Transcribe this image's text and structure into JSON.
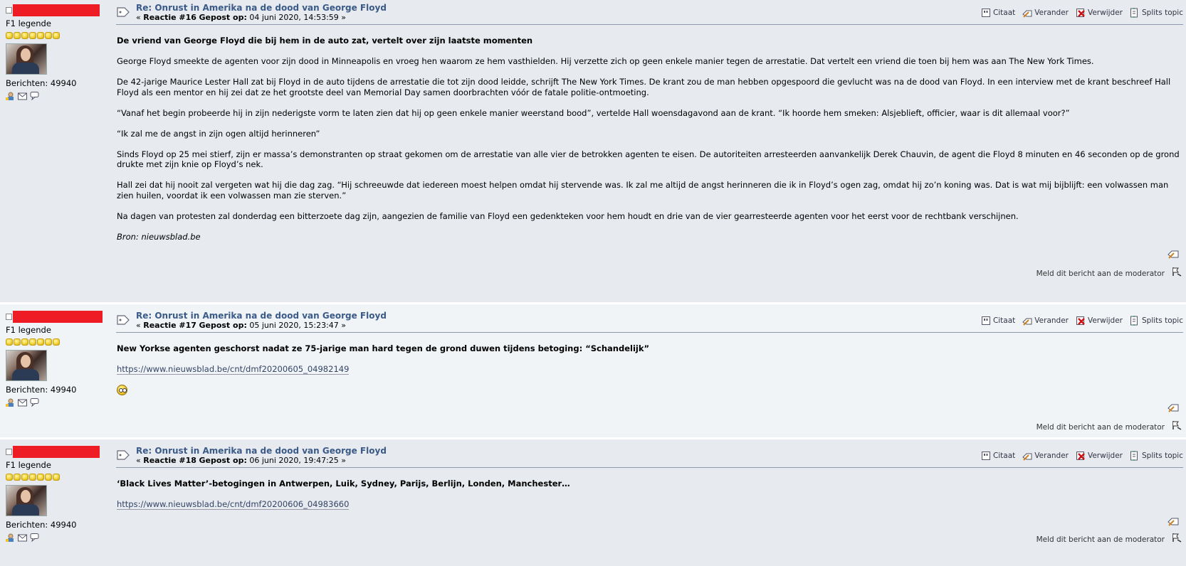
{
  "colors": {
    "subject": "#3a5a88",
    "redaction": "#ee1c25",
    "post_bg_dark": "#e7eaef",
    "post_bg_light": "#f0f4f7"
  },
  "posts": [
    {
      "poster": {
        "rank": "F1 legende",
        "stars": 7,
        "post_count": "Berichten: 49940"
      },
      "subject": "Re: Onrust in Amerika na de dood van George Floyd",
      "reply_label": "Reactie #16",
      "posted_label": "Gepost op:",
      "date": "04 juni 2020, 14:53:59",
      "buttons": {
        "quote": "Citaat",
        "modify": "Verander",
        "remove": "Verwijder",
        "split": "Splits topic"
      },
      "body": [
        {
          "style": "lead",
          "text": "De vriend van George Floyd die bij hem in de auto zat, vertelt over zijn laatste momenten"
        },
        {
          "style": "p",
          "text": "George Floyd smeekte de agenten voor zijn dood in Minneapolis en vroeg hen waarom ze hem vasthielden. Hij verzette zich op geen enkele manier tegen de arrestatie. Dat vertelt een vriend die toen bij hem was aan The New York Times."
        },
        {
          "style": "p",
          "text": "De 42-jarige Maurice Lester Hall zat bij Floyd in de auto tijdens de arrestatie die tot zijn dood leidde, schrijft The New York Times. De krant zou de man hebben opgespoord die gevlucht was na de dood van Floyd. In een interview met de krant beschreef Hall Floyd als een mentor en hij zei dat ze het grootste deel van Memorial Day samen doorbrachten vóór de fatale politie-ontmoeting."
        },
        {
          "style": "p",
          "text": "“Vanaf het begin probeerde hij in zijn nederigste vorm te laten zien dat hij op geen enkele manier weerstand bood”, vertelde Hall woensdagavond aan de krant. “Ik hoorde hem smeken: Alsjeblieft, officier, waar is dit allemaal voor?”"
        },
        {
          "style": "p",
          "text": "“Ik zal me de angst in zijn ogen altijd herinneren”"
        },
        {
          "style": "p",
          "text": "Sinds Floyd op 25 mei stierf, zijn er massa’s demonstranten op straat gekomen om de arrestatie van alle vier de betrokken agenten te eisen. De autoriteiten arresteerden aanvankelijk Derek Chauvin, de agent die Floyd 8 minuten en 46 seconden op de grond drukte met zijn knie op Floyd’s nek."
        },
        {
          "style": "p",
          "text": "Hall zei dat hij nooit zal vergeten wat hij die dag zag. “Hij schreeuwde dat iedereen moest helpen omdat hij stervende was. Ik zal me altijd de angst herinneren die ik in Floyd’s ogen zag, omdat hij zo’n koning was. Dat is wat mij bijblijft: een volwassen man zien huilen, voordat ik een volwassen man zie sterven.”"
        },
        {
          "style": "p",
          "text": "Na dagen van protesten zal donderdag een bitterzoete dag zijn, aangezien de familie van Floyd een gedenkteken voor hem houdt en drie van de vier gearresteerde agenten voor het eerst voor de rechtbank verschijnen."
        },
        {
          "style": "src",
          "text": "Bron: nieuwsblad.be"
        }
      ],
      "report": "Meld dit bericht aan de moderator"
    },
    {
      "poster": {
        "rank": "F1 legende",
        "stars": 7,
        "post_count": "Berichten: 49940"
      },
      "subject": "Re: Onrust in Amerika na de dood van George Floyd",
      "reply_label": "Reactie #17",
      "posted_label": "Gepost op:",
      "date": "05 juni 2020, 15:23:47",
      "buttons": {
        "quote": "Citaat",
        "modify": "Verander",
        "remove": "Verwijder",
        "split": "Splits topic"
      },
      "body": [
        {
          "style": "lead",
          "text": "New Yorkse agenten geschorst nadat ze 75-jarige man hard tegen de grond duwen tijdens betoging: “Schandelijk”"
        },
        {
          "style": "link",
          "text": "https://www.nieuwsblad.be/cnt/dmf20200605_04982149"
        },
        {
          "style": "smiley",
          "text": ""
        }
      ],
      "report": "Meld dit bericht aan de moderator"
    },
    {
      "poster": {
        "rank": "F1 legende",
        "stars": 7,
        "post_count": "Berichten: 49940"
      },
      "subject": "Re: Onrust in Amerika na de dood van George Floyd",
      "reply_label": "Reactie #18",
      "posted_label": "Gepost op:",
      "date": "06 juni 2020, 19:47:25",
      "buttons": {
        "quote": "Citaat",
        "modify": "Verander",
        "remove": "Verwijder",
        "split": "Splits topic"
      },
      "body": [
        {
          "style": "lead",
          "text": "‘Black Lives Matter’-betogingen in Antwerpen, Luik, Sydney, Parijs, Berlijn, Londen, Manchester…"
        },
        {
          "style": "link",
          "text": "https://www.nieuwsblad.be/cnt/dmf20200606_04983660"
        }
      ],
      "report": "Meld dit bericht aan de moderator"
    }
  ]
}
